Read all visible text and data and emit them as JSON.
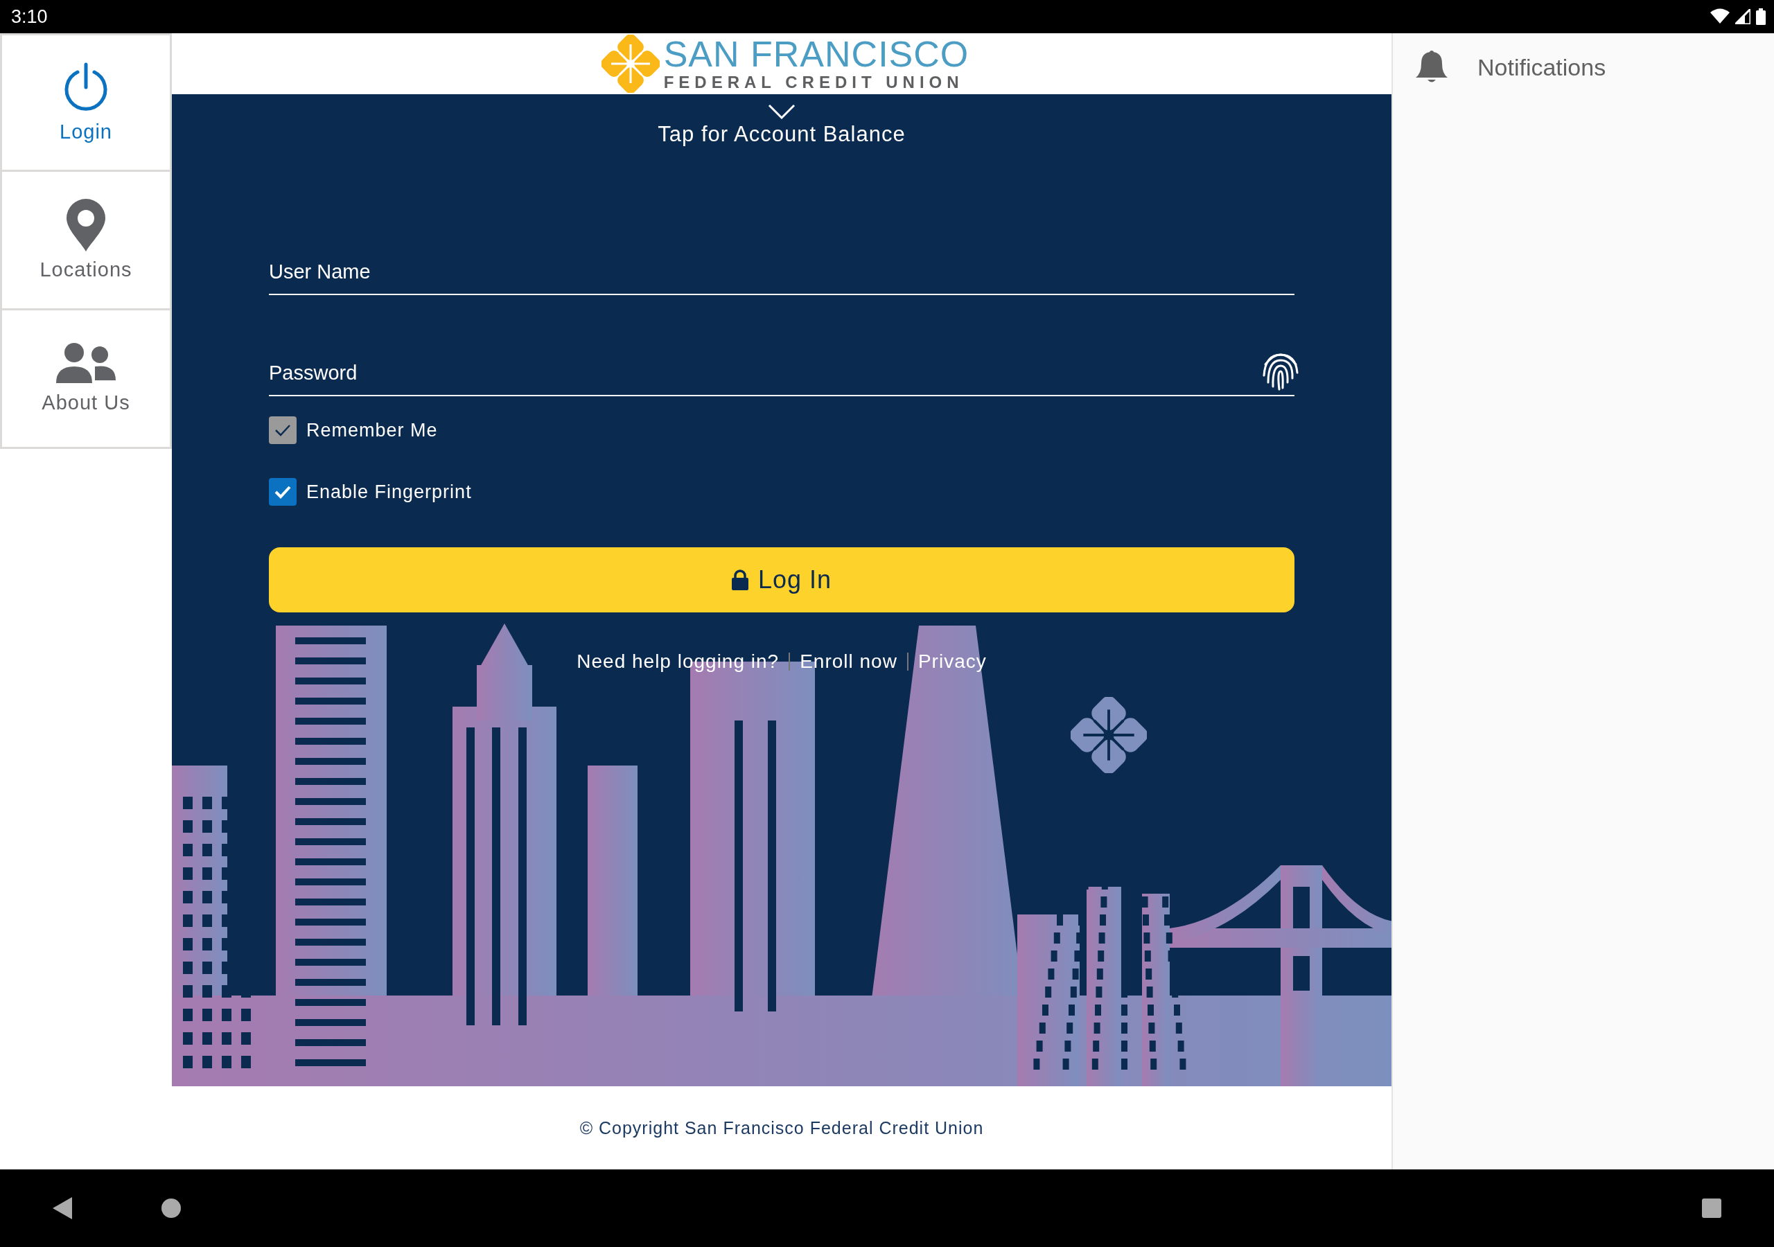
{
  "status_bar": {
    "time": "3:10"
  },
  "sidebar": {
    "items": [
      {
        "label": "Login",
        "kind": "power",
        "selected": true
      },
      {
        "label": "Locations",
        "kind": "pin",
        "selected": false
      },
      {
        "label": "About Us",
        "kind": "people",
        "selected": false
      }
    ]
  },
  "header": {
    "logo": {
      "name": "SAN FRANCISCO",
      "subtitle": "FEDERAL CREDIT UNION"
    }
  },
  "balance_toggle": {
    "label": "Tap for Account Balance"
  },
  "form": {
    "fields": [
      {
        "placeholder": "User Name",
        "kind": "text"
      },
      {
        "placeholder": "Password",
        "kind": "password"
      }
    ],
    "checkboxes": [
      {
        "label": "Remember Me",
        "checked": true,
        "disabled": true
      },
      {
        "label": "Enable Fingerprint",
        "checked": true,
        "disabled": false
      }
    ],
    "login_button": {
      "label": "Log In"
    }
  },
  "links": [
    "Need help logging in?",
    "Enroll now",
    "Privacy"
  ],
  "footer": {
    "copyright": "© Copyright San Francisco Federal Credit Union"
  },
  "notifications": {
    "title": "Notifications"
  }
}
